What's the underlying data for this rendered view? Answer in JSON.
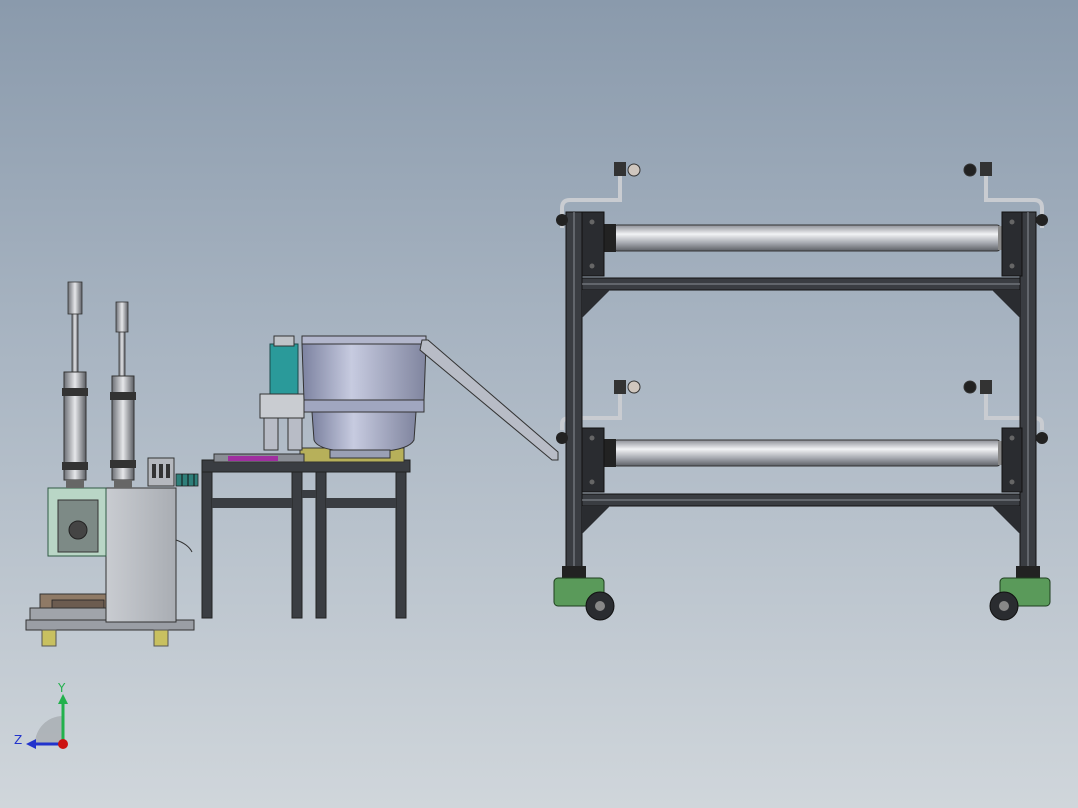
{
  "viewport": {
    "background_top": "#8a9aac",
    "background_bottom": "#d0d6db"
  },
  "triad": {
    "y_label": "Y",
    "z_label": "Z",
    "y_color": "#22b14c",
    "z_color": "#2233cc",
    "x_color": "#cc1111"
  },
  "colors": {
    "steel": "#b8bcc6",
    "frame_dark": "#3a3d42",
    "wheel_green": "#5a9a5a",
    "bowl": "#9ea4c0",
    "motor_teal": "#2a9a9a",
    "magenta_part": "#a030a0",
    "base_yellow": "#c8c060"
  }
}
